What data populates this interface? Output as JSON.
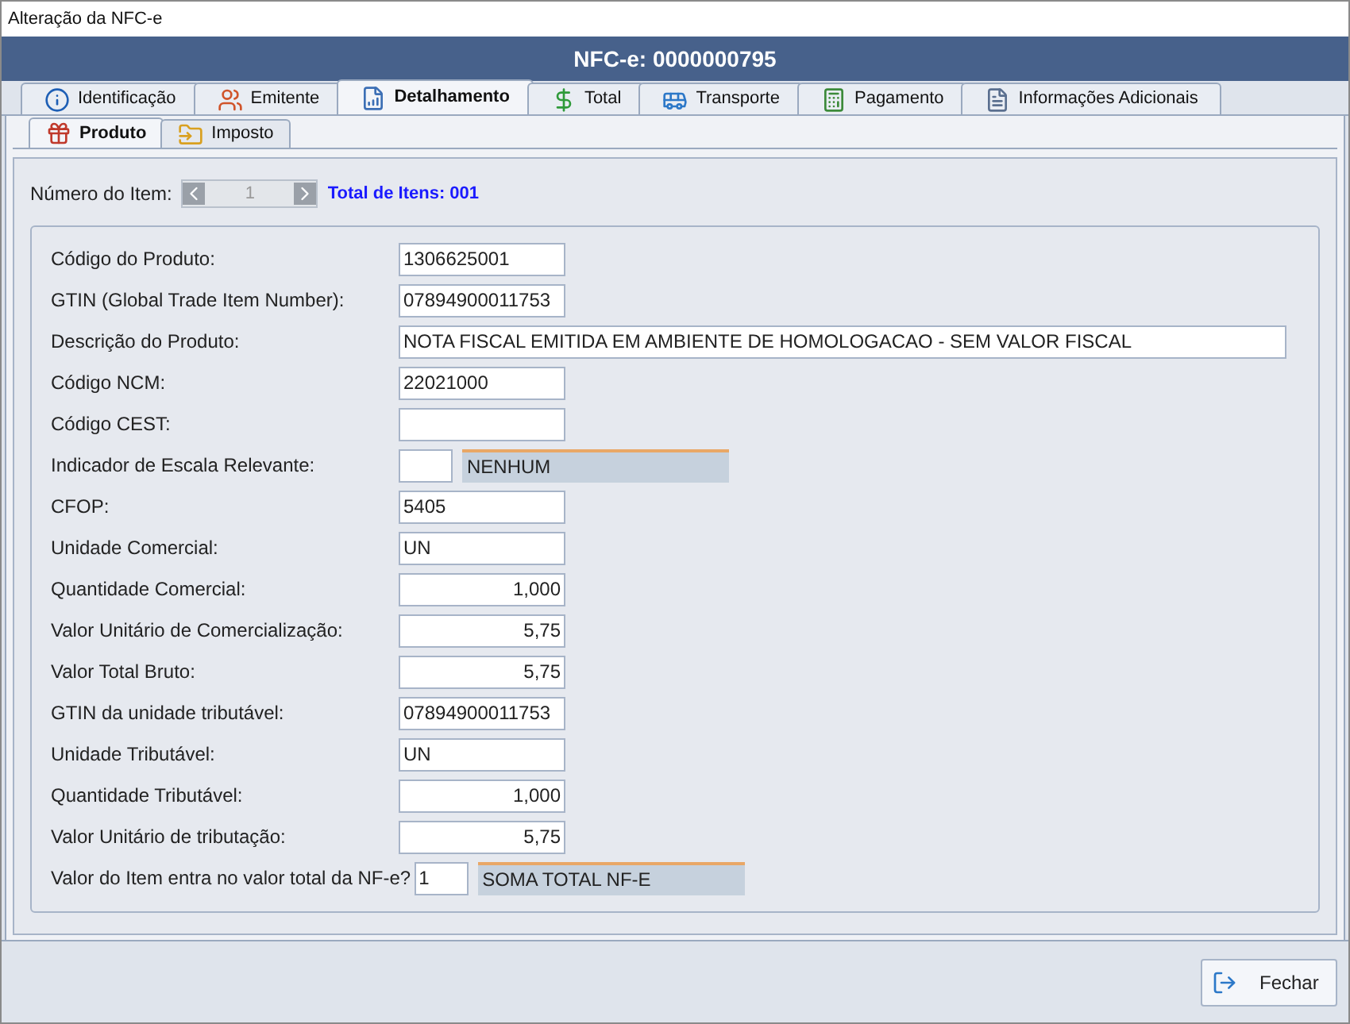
{
  "window": {
    "title": "Alteração da NFC-e"
  },
  "header": {
    "title": "NFC-e: 0000000795"
  },
  "tabs": [
    {
      "label": "Identificação",
      "selected": false
    },
    {
      "label": "Emitente",
      "selected": false
    },
    {
      "label": "Detalhamento",
      "selected": true
    },
    {
      "label": "Total",
      "selected": false
    },
    {
      "label": "Transporte",
      "selected": false
    },
    {
      "label": "Pagamento",
      "selected": false
    },
    {
      "label": "Informações Adicionais",
      "selected": false
    }
  ],
  "subtabs": [
    {
      "label": "Produto",
      "selected": true
    },
    {
      "label": "Imposto",
      "selected": false
    }
  ],
  "item_nav": {
    "label": "Número do Item:",
    "value": "1",
    "total": "Total de Itens: 001"
  },
  "fields": [
    {
      "label": "Código do Produto:",
      "kind": "text",
      "value": "1306625001"
    },
    {
      "label": "GTIN (Global Trade Item Number):",
      "kind": "text",
      "value": "07894900011753"
    },
    {
      "label": "Descrição do Produto:",
      "kind": "wide",
      "value": "NOTA FISCAL EMITIDA EM AMBIENTE DE HOMOLOGACAO - SEM VALOR FISCAL"
    },
    {
      "label": "Código NCM:",
      "kind": "text",
      "value": "22021000"
    },
    {
      "label": "Código CEST:",
      "kind": "text"
    },
    {
      "label": "Indicador de Escala Relevante:",
      "kind": "code",
      "description": "NENHUM"
    },
    {
      "label": "CFOP:",
      "kind": "text",
      "value": "5405"
    },
    {
      "label": "Unidade Comercial:",
      "kind": "text",
      "value": "UN"
    },
    {
      "label": "Quantidade Comercial:",
      "kind": "number",
      "value": "1,000"
    },
    {
      "label": "Valor Unitário de Comercialização:",
      "kind": "number",
      "value": "5,75"
    },
    {
      "label": "Valor Total Bruto:",
      "kind": "number",
      "value": "5,75"
    },
    {
      "label": "GTIN da unidade tributável:",
      "kind": "text",
      "value": "07894900011753"
    },
    {
      "label": "Unidade Tributável:",
      "kind": "text",
      "value": "UN"
    },
    {
      "label": "Quantidade Tributável:",
      "kind": "number",
      "value": "1,000"
    },
    {
      "label": "Valor Unitário de tributação:",
      "kind": "number",
      "value": "5,75"
    },
    {
      "label": "Valor do Item entra no valor total da NF-e?",
      "kind": "code",
      "value": "1",
      "description": "SOMA TOTAL NF-E"
    }
  ],
  "buttons": [
    {
      "label": "Fechar"
    }
  ]
}
